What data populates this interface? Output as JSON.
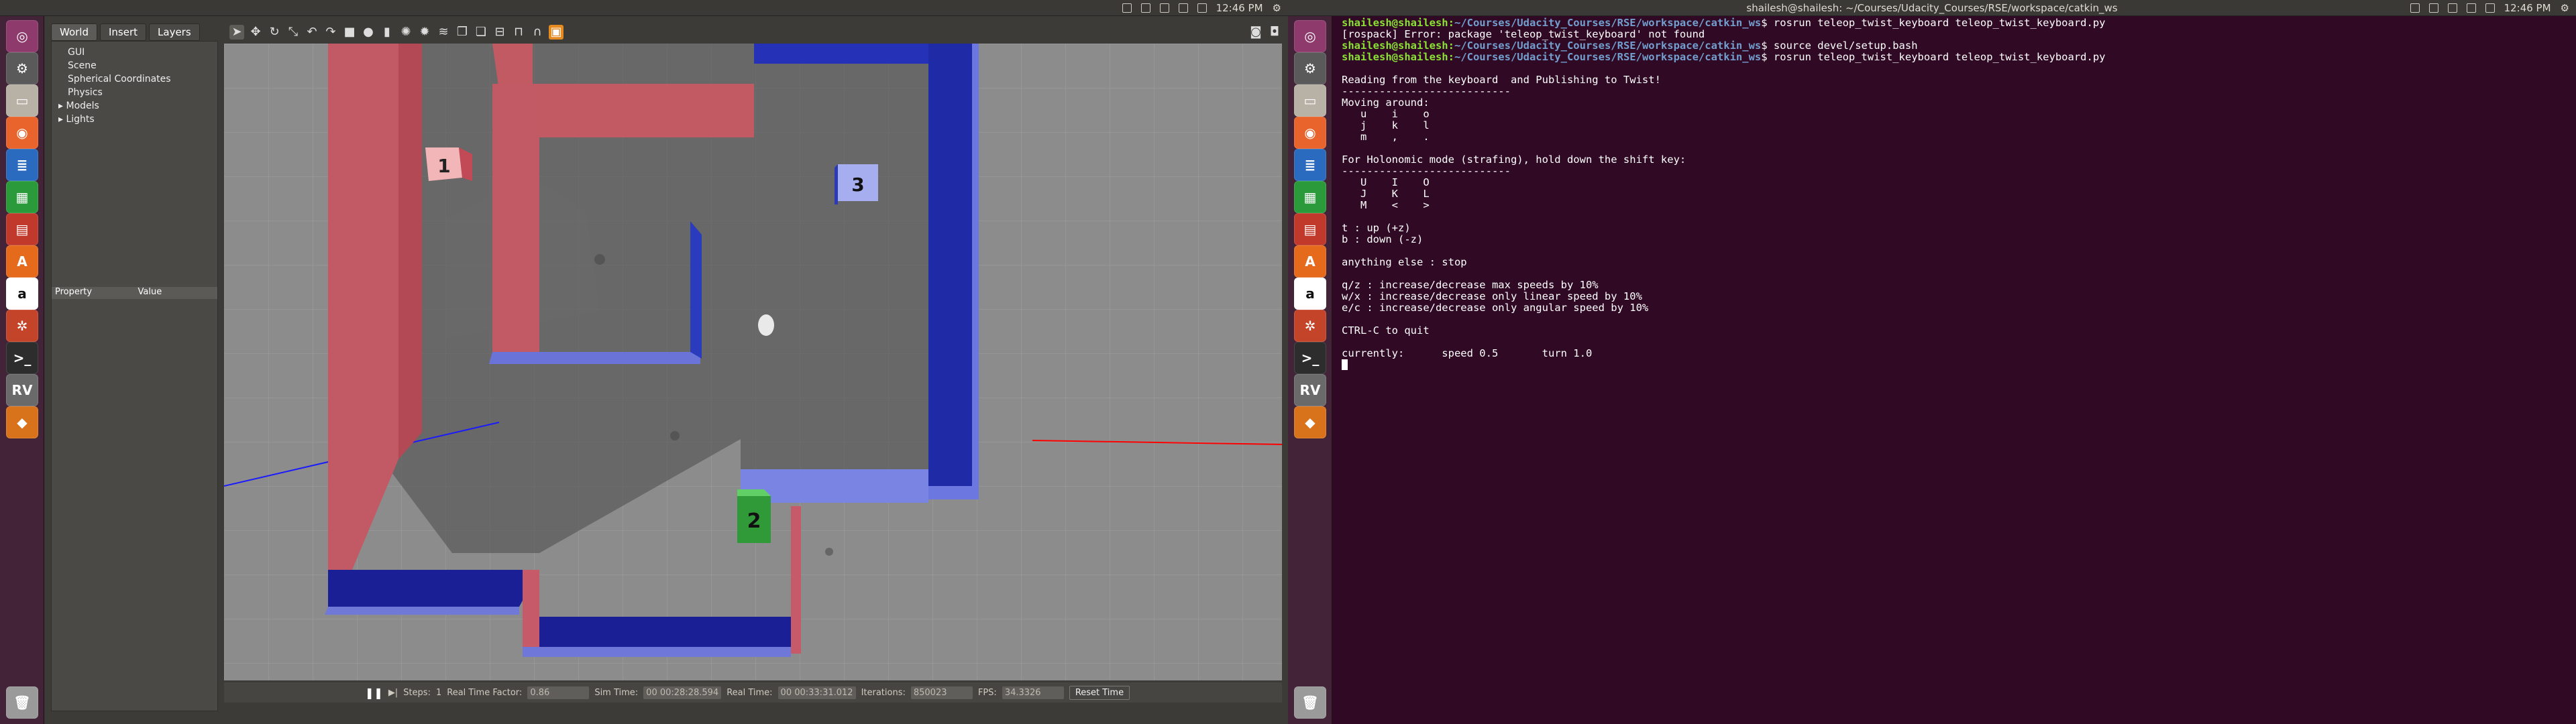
{
  "left_screen": {
    "topbar": {
      "time": "12:46 PM",
      "indicators": [
        "chrome-icon",
        "en-input-icon",
        "bluetooth-icon",
        "battery-icon",
        "volume-icon",
        "gear-icon"
      ]
    },
    "launcher": {
      "apps": [
        "dash-icon",
        "gazebo-icon",
        "files-icon",
        "firefox-icon",
        "writer-icon",
        "calc-icon",
        "impress-icon",
        "fonts-icon",
        "amazon-icon",
        "settings-icon",
        "terminal-icon",
        "rviz-icon",
        "sublime-icon",
        "trash-icon"
      ]
    },
    "gazebo": {
      "tabs": [
        "World",
        "Insert",
        "Layers"
      ],
      "active_tab": "World",
      "tree": [
        "GUI",
        "Scene",
        "Spherical Coordinates",
        "Physics",
        "Models",
        "Lights"
      ],
      "property_header": {
        "col1": "Property",
        "col2": "Value"
      },
      "toolbar_tools": [
        "select-icon",
        "translate-icon",
        "rotate-icon",
        "scale-icon",
        "undo-icon",
        "redo-icon",
        "box-icon",
        "sphere-icon",
        "cylinder-icon",
        "point-light-icon",
        "spot-light-icon",
        "directional-light-icon",
        "copy-icon",
        "paste-icon",
        "align-icon",
        "snap-icon",
        "magnet-icon",
        "orange-icon",
        "screenshot-icon",
        "record-icon"
      ],
      "scene_markers": [
        "1",
        "2",
        "3"
      ],
      "status_bar": {
        "steps_label": "Steps:",
        "steps_value": "1",
        "rtf_label": "Real Time Factor:",
        "rtf_value": "0.86",
        "sim_time_label": "Sim Time:",
        "sim_time_value": "00 00:28:28.594",
        "real_time_label": "Real Time:",
        "real_time_value": "00 00:33:31.012",
        "iterations_label": "Iterations:",
        "iterations_value": "850023",
        "fps_label": "FPS:",
        "fps_value": "34.3326",
        "reset_label": "Reset Time"
      }
    }
  },
  "right_screen": {
    "topbar": {
      "title": "shailesh@shailesh: ~/Courses/Udacity_Courses/RSE/workspace/catkin_ws",
      "time": "12:46 PM"
    },
    "terminal": {
      "lines": [
        {
          "prompt": "shailesh@shailesh",
          "path": "~/Courses/Udacity_Courses/RSE/workspace/catkin_ws",
          "cmd": "$ rosrun teleop_twist_keyboard teleop_twist_keyboard.py"
        },
        {
          "text": "[rospack] Error: package 'teleop_twist_keyboard' not found"
        },
        {
          "prompt": "shailesh@shailesh",
          "path": "~/Courses/Udacity_Courses/RSE/workspace/catkin_ws",
          "cmd": "$ source devel/setup.bash"
        },
        {
          "prompt": "shailesh@shailesh",
          "path": "~/Courses/Udacity_Courses/RSE/workspace/catkin_ws",
          "cmd": "$ rosrun teleop_twist_keyboard teleop_twist_keyboard.py"
        },
        {
          "text": ""
        },
        {
          "text": "Reading from the keyboard  and Publishing to Twist!"
        },
        {
          "text": "---------------------------"
        },
        {
          "text": "Moving around:"
        },
        {
          "text": "   u    i    o"
        },
        {
          "text": "   j    k    l"
        },
        {
          "text": "   m    ,    ."
        },
        {
          "text": ""
        },
        {
          "text": "For Holonomic mode (strafing), hold down the shift key:"
        },
        {
          "text": "---------------------------"
        },
        {
          "text": "   U    I    O"
        },
        {
          "text": "   J    K    L"
        },
        {
          "text": "   M    <    >"
        },
        {
          "text": ""
        },
        {
          "text": "t : up (+z)"
        },
        {
          "text": "b : down (-z)"
        },
        {
          "text": ""
        },
        {
          "text": "anything else : stop"
        },
        {
          "text": ""
        },
        {
          "text": "q/z : increase/decrease max speeds by 10%"
        },
        {
          "text": "w/x : increase/decrease only linear speed by 10%"
        },
        {
          "text": "e/c : increase/decrease only angular speed by 10%"
        },
        {
          "text": ""
        },
        {
          "text": "CTRL-C to quit"
        },
        {
          "text": ""
        },
        {
          "text": "currently:      speed 0.5       turn 1.0"
        }
      ]
    }
  },
  "colors": {
    "terminal_bg": "#300a24",
    "prompt_user": "#8ae234",
    "prompt_path": "#729fcf",
    "wall_red": "#c25a63",
    "wall_blue": "#1d2aa0",
    "box_green": "#33a13a"
  }
}
